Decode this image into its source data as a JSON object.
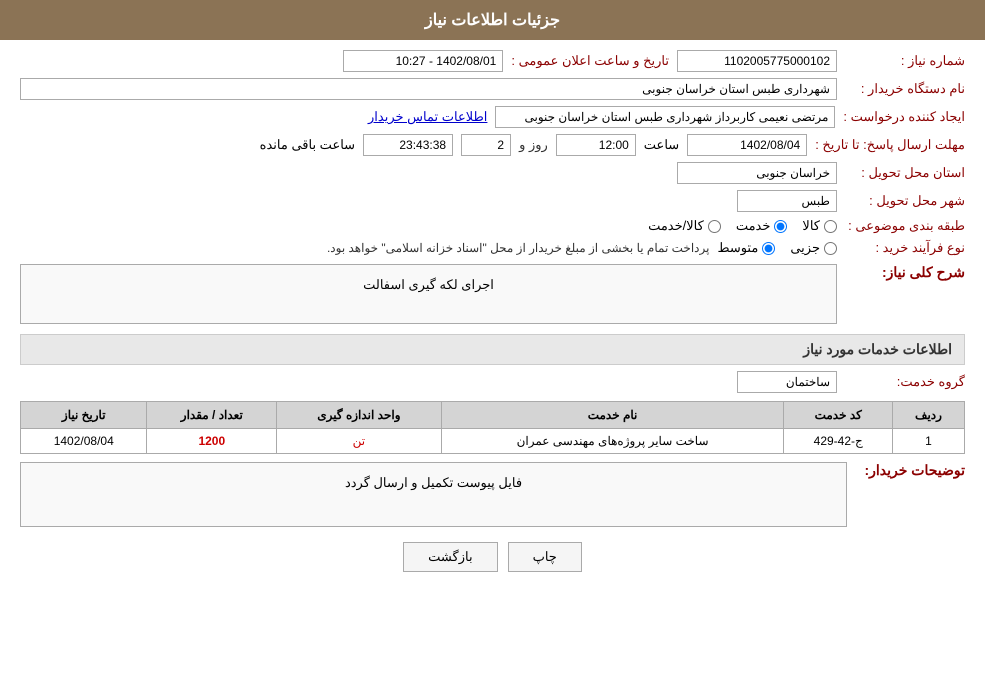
{
  "header": {
    "title": "جزئیات اطلاعات نیاز"
  },
  "fields": {
    "niaz_number_label": "شماره نیاز :",
    "niaz_number_value": "1102005775000102",
    "announcement_date_label": "تاریخ و ساعت اعلان عمومی :",
    "announcement_date_value": "1402/08/01 - 10:27",
    "buyer_org_label": "نام دستگاه خریدار :",
    "buyer_org_value": "شهرداری طبس استان خراسان جنوبی",
    "creator_label": "ایجاد کننده درخواست :",
    "creator_value": "مرتضی نعیمی کاربرداز شهرداری طبس استان خراسان جنوبی",
    "contact_link": "اطلاعات تماس خریدار",
    "deadline_label": "مهلت ارسال پاسخ: تا تاریخ :",
    "deadline_date": "1402/08/04",
    "deadline_time": "12:00",
    "deadline_days": "2",
    "deadline_remaining_label": "ساعت باقی مانده",
    "deadline_remaining_time": "23:43:38",
    "province_label": "استان محل تحویل :",
    "province_value": "خراسان جنوبی",
    "city_label": "شهر محل تحویل :",
    "city_value": "طبس",
    "category_label": "طبقه بندی موضوعی :",
    "category_options": [
      {
        "id": "kala",
        "label": "کالا"
      },
      {
        "id": "khedmat",
        "label": "خدمت"
      },
      {
        "id": "kala_khedmat",
        "label": "کالا/خدمت"
      }
    ],
    "category_selected": "khedmat",
    "purchase_type_label": "نوع فرآیند خرید :",
    "purchase_type_options": [
      {
        "id": "jozii",
        "label": "جزیی"
      },
      {
        "id": "motavasset",
        "label": "متوسط"
      }
    ],
    "purchase_type_selected": "motavasset",
    "purchase_notice": "پرداخت تمام یا بخشی از مبلغ خریدار از محل \"اسناد خزانه اسلامی\" خواهد بود.",
    "description_label": "شرح کلی نیاز:",
    "description_value": "اجرای لکه گیری اسفالت",
    "services_section_label": "اطلاعات خدمات مورد نیاز",
    "service_group_label": "گروه خدمت:",
    "service_group_value": "ساختمان",
    "table_headers": {
      "row_num": "ردیف",
      "service_code": "کد خدمت",
      "service_name": "نام خدمت",
      "measurement_unit": "واحد اندازه گیری",
      "quantity": "تعداد / مقدار",
      "date": "تاریخ نیاز"
    },
    "table_rows": [
      {
        "row_num": "1",
        "service_code": "ج-42-429",
        "service_name": "ساخت سایر پروژه‌های مهندسی عمران",
        "measurement_unit": "تن",
        "quantity": "1200",
        "date": "1402/08/04"
      }
    ],
    "buyer_description_label": "توضیحات خریدار:",
    "buyer_description_value": "فایل پیوست تکمیل و ارسال گردد",
    "btn_print": "چاپ",
    "btn_back": "بازگشت"
  }
}
